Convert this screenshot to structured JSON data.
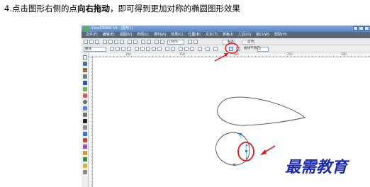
{
  "instruction": {
    "prefix": "4.点击图形右侧的点",
    "bold": "向右拖动",
    "suffix": "，即可得到更加对称的椭圆图形效果"
  },
  "app": {
    "title": "CorelDRAW X4 - [图形1]",
    "menu": [
      "文件(F)",
      "编辑(E)",
      "视图(V)",
      "布局(L)",
      "排列(A)",
      "效果(C)",
      "位图(B)",
      "文本(T)",
      "表格(I)",
      "工具(O)",
      "窗口(W)",
      "帮助(H)"
    ],
    "toolbar": {
      "zoom": "100%",
      "snap_label": "贴齐",
      "btn1": "贴齐",
      "btn2": "选项"
    },
    "propbar": {
      "object_select": "曲线",
      "smooth_label": "曲线平滑度",
      "smooth_value": "0"
    },
    "ruler_ticks": [
      "100",
      "150",
      "200",
      "250",
      "300"
    ]
  },
  "watermark": {
    "text": "最需教育",
    "color": "#1d2aa8"
  },
  "colors": {
    "annotation_red": "#e3161d",
    "node_blue": "#2b7fd8"
  }
}
